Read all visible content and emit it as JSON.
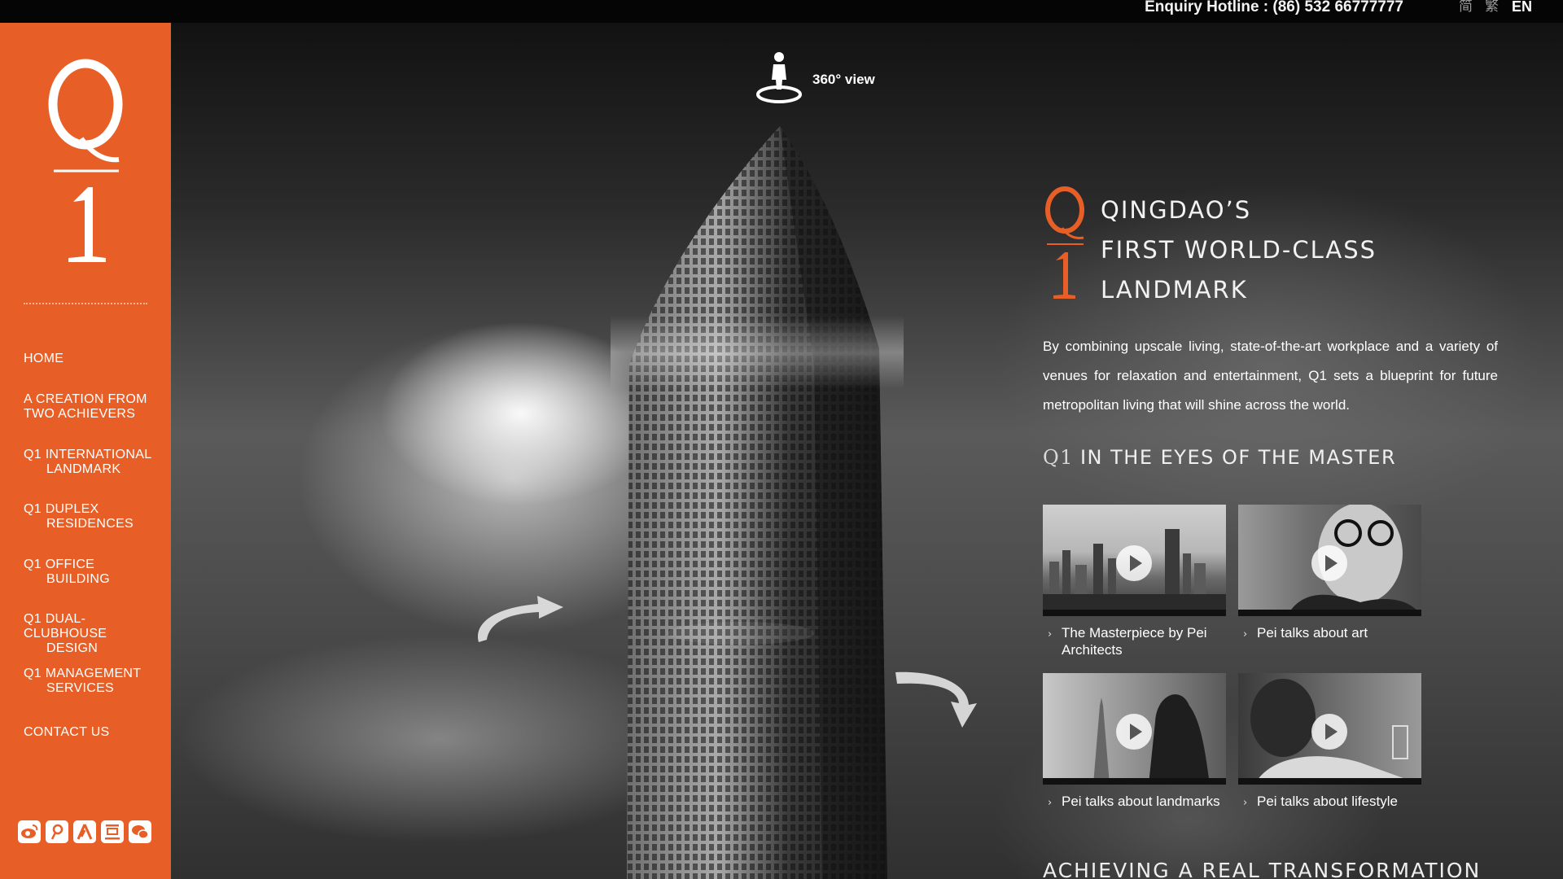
{
  "topbar": {
    "hotline": "Enquiry Hotline : (86) 532 66777777",
    "languages": [
      {
        "label": "简",
        "active": false
      },
      {
        "label": "繁",
        "active": false
      },
      {
        "label": "EN",
        "active": true
      }
    ]
  },
  "sidebar": {
    "logo_text": "Q1",
    "nav": [
      {
        "line1": "HOME",
        "line2": ""
      },
      {
        "line1": "A CREATION FROM",
        "line2": "TWO ACHIEVERS"
      },
      {
        "line1": "Q1 INTERNATIONAL",
        "line2": "LANDMARK"
      },
      {
        "line1": "Q1 DUPLEX",
        "line2": "RESIDENCES"
      },
      {
        "line1": "Q1 OFFICE",
        "line2": "BUILDING"
      },
      {
        "line1": "Q1 DUAL-CLUBHOUSE",
        "line2": "DESIGN"
      },
      {
        "line1": "Q1 MANAGEMENT",
        "line2": "SERVICES"
      },
      {
        "line1": "CONTACT US",
        "line2": ""
      }
    ],
    "social_icons": [
      "weibo-icon",
      "tencent-weibo-icon",
      "renren-icon",
      "douban-icon",
      "wechat-icon"
    ]
  },
  "hero": {
    "view360_label": "360° view"
  },
  "content": {
    "headline": [
      "QINGDAO’S",
      "FIRST WORLD-CLASS",
      "LANDMARK"
    ],
    "intro": "By combining upscale living, state-of-the-art workplace and a variety of venues for relaxation and entertainment, Q1 sets a blueprint for future metropolitan living that will shine across the world.",
    "section_prefix": "Q1",
    "section_title": "IN THE EYES OF THE MASTER",
    "videos": [
      {
        "caption": "The Masterpiece by Pei Architects"
      },
      {
        "caption": "Pei talks about art"
      },
      {
        "caption": "Pei talks about landmarks"
      },
      {
        "caption": "Pei talks about lifestyle"
      }
    ],
    "next_section_title": "ACHIEVING A REAL TRANSFORMATION"
  },
  "colors": {
    "brand_orange": "#e75f26",
    "topbar": "#050505"
  }
}
